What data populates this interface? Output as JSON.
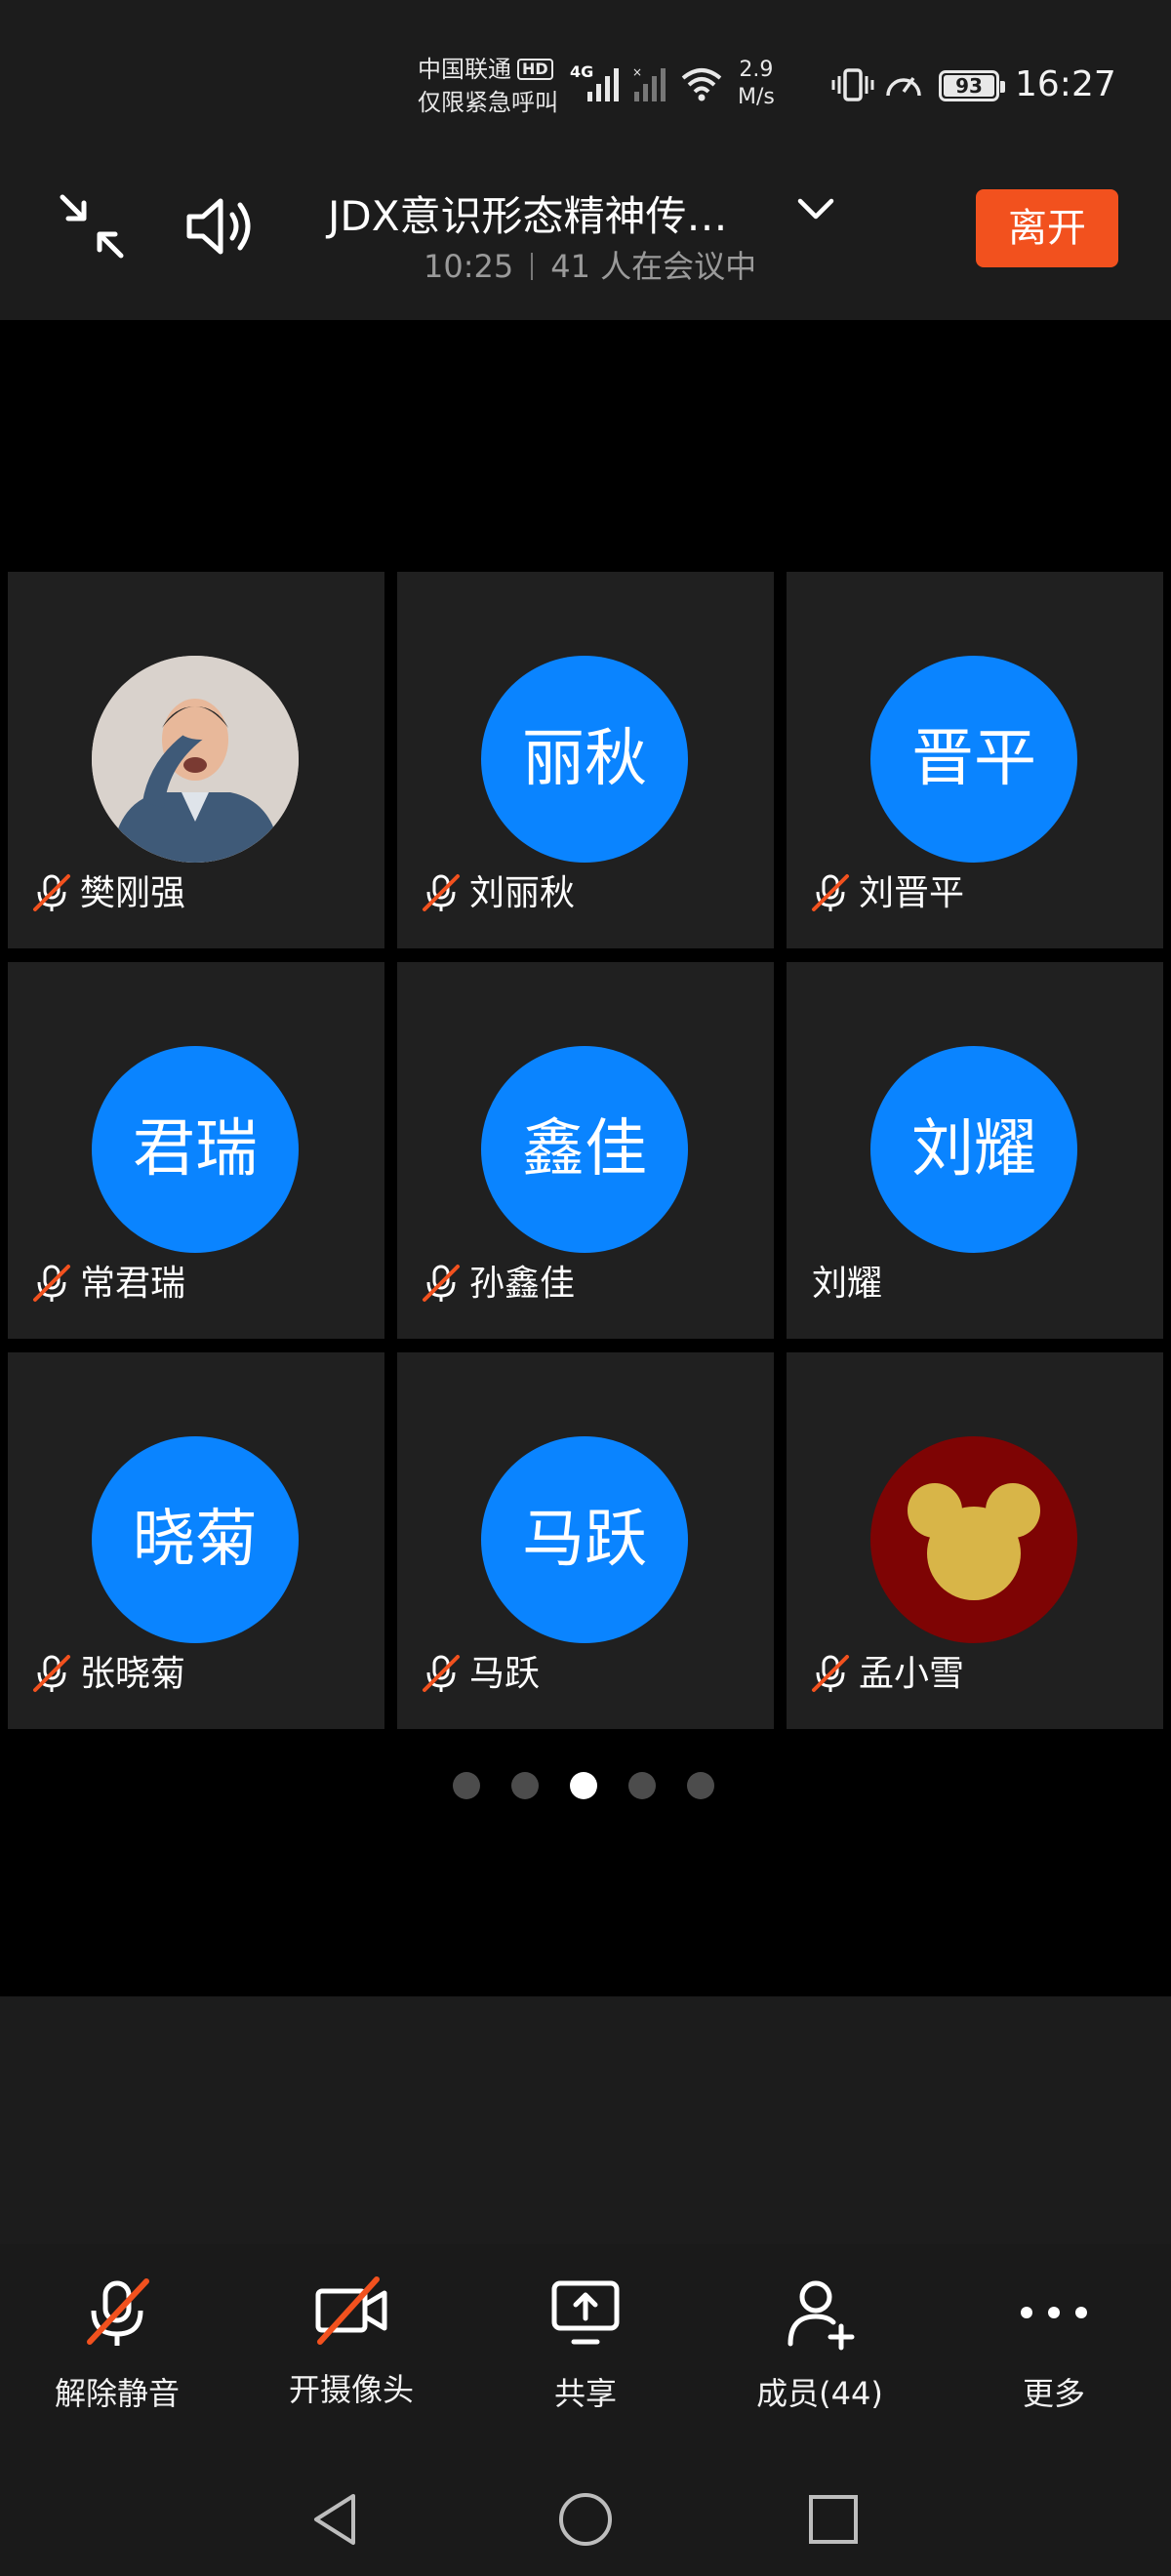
{
  "status_bar": {
    "carrier_line1": "中国联通",
    "hd_badge": "HD",
    "carrier_line2": "仅限紧急呼叫",
    "network_type": "4G",
    "speed_value": "2.9",
    "speed_unit": "M/s",
    "battery": "93",
    "time": "16:27"
  },
  "header": {
    "title": "JDX意识形态精神传…",
    "elapsed": "10:25",
    "participants_text": "41 人在会议中",
    "leave_label": "离开"
  },
  "participants": [
    {
      "avatar_text": "",
      "avatar_type": "photo",
      "name": "樊刚强",
      "muted": true
    },
    {
      "avatar_text": "丽秋",
      "avatar_type": "initials",
      "name": "刘丽秋",
      "muted": true
    },
    {
      "avatar_text": "晋平",
      "avatar_type": "initials",
      "name": "刘晋平",
      "muted": true
    },
    {
      "avatar_text": "君瑞",
      "avatar_type": "initials",
      "name": "常君瑞",
      "muted": true
    },
    {
      "avatar_text": "鑫佳",
      "avatar_type": "initials",
      "name": "孙鑫佳",
      "muted": true
    },
    {
      "avatar_text": "刘耀",
      "avatar_type": "initials",
      "name": "刘耀",
      "muted": false
    },
    {
      "avatar_text": "晓菊",
      "avatar_type": "initials",
      "name": "张晓菊",
      "muted": true
    },
    {
      "avatar_text": "马跃",
      "avatar_type": "initials",
      "name": "马跃",
      "muted": true
    },
    {
      "avatar_text": "",
      "avatar_type": "mickey-image",
      "name": "孟小雪",
      "muted": true
    }
  ],
  "pagination": {
    "total": 5,
    "active_index": 2
  },
  "toolbar": {
    "unmute_label": "解除静音",
    "camera_label": "开摄像头",
    "share_label": "共享",
    "members_label": "成员(44)",
    "more_label": "更多"
  },
  "colors": {
    "avatar_blue": "#0a84ff",
    "leave_orange": "#f2511e",
    "mute_slash": "#f2511e",
    "tile_bg": "#202020"
  },
  "icons": [
    "exit-fullscreen-icon",
    "speaker-icon",
    "chevron-down-icon",
    "mic-muted-icon",
    "camera-off-icon",
    "share-screen-icon",
    "add-member-icon",
    "more-dots-icon",
    "nav-back-icon",
    "nav-home-icon",
    "nav-recents-icon"
  ]
}
